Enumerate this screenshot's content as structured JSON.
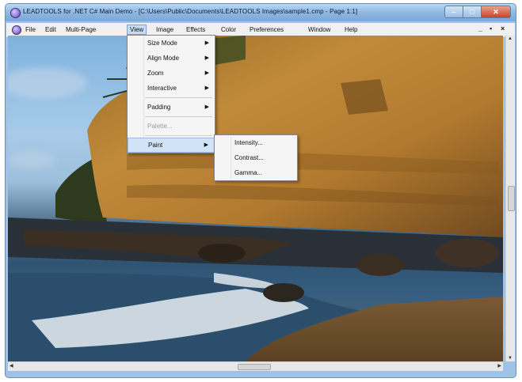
{
  "window": {
    "title": "LEADTOOLS for .NET C# Main Demo - [C:\\Users\\Public\\Documents\\LEADTOOLS Images\\sample1.cmp - Page 1:1]"
  },
  "menubar": {
    "items": [
      "File",
      "Edit",
      "Multi-Page",
      "View",
      "Image",
      "Effects",
      "Color",
      "Preferences",
      "Window",
      "Help"
    ],
    "active": "View",
    "mdi_controls": [
      "_",
      "▪",
      "×"
    ]
  },
  "view_menu": {
    "items": [
      {
        "label": "Size Mode",
        "submenu": true
      },
      {
        "label": "Align Mode",
        "submenu": true
      },
      {
        "label": "Zoom",
        "submenu": true
      },
      {
        "label": "Interactive",
        "submenu": true
      },
      {
        "label": "Padding",
        "submenu": true
      },
      {
        "label": "Palette...",
        "disabled": true
      },
      {
        "label": "Paint",
        "submenu": true,
        "highlighted": true
      }
    ]
  },
  "paint_submenu": {
    "items": [
      "Intensity...",
      "Contrast...",
      "Gamma..."
    ]
  },
  "colors": {
    "titlebar": "#8fb7e0",
    "menu_highlight": "#d1e3f7"
  }
}
